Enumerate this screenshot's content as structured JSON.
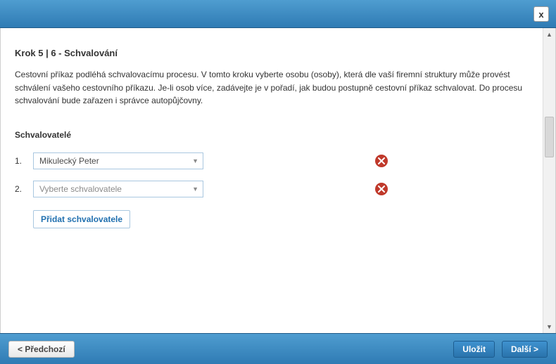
{
  "header": {
    "close_label": "x"
  },
  "step": {
    "title": "Krok 5 | 6 - Schvalování"
  },
  "description": "Cestovní příkaz podléhá schvalovacímu procesu. V tomto kroku vyberte osobu (osoby), která dle vaší firemní struktury může provést schválení vašeho cestovního příkazu. Je-li osob více, zadávejte je v pořadí, jak budou postupně cestovní příkaz schvalovat. Do procesu schvalování bude zařazen i správce autopůjčovny.",
  "section_title": "Schvalovatelé",
  "approvers": {
    "rows": [
      {
        "num": "1.",
        "value": "Mikulecký Peter",
        "is_placeholder": false
      },
      {
        "num": "2.",
        "value": "Vyberte schvalovatele",
        "is_placeholder": true
      }
    ],
    "add_label": "Přidat schvalovatele"
  },
  "footer": {
    "prev": "< Předchozí",
    "save": "Uložit",
    "next": "Další >"
  }
}
